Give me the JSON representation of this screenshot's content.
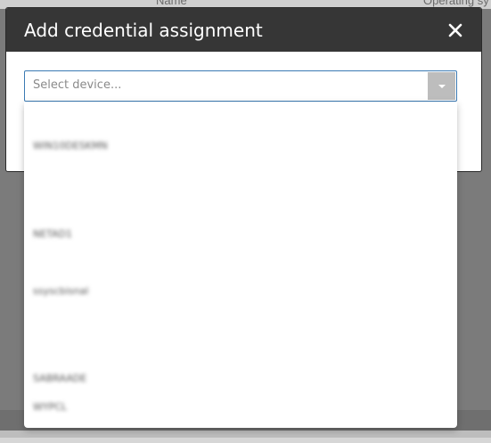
{
  "background_table": {
    "columns": [
      "Name",
      "Operating sy"
    ]
  },
  "modal": {
    "title": "Add credential assignment",
    "close_icon": "close-icon"
  },
  "device_select": {
    "placeholder": "Select device...",
    "arrow_icon": "caret-down-icon",
    "options": [
      "WIN10DESKMN",
      "NETAD1",
      "ssyscbisnal",
      "SABRAADE",
      "WYPCL"
    ]
  },
  "colors": {
    "header_bg": "#363636",
    "focus_border": "#3b7ab3",
    "overlay": "#7b7b7b"
  }
}
